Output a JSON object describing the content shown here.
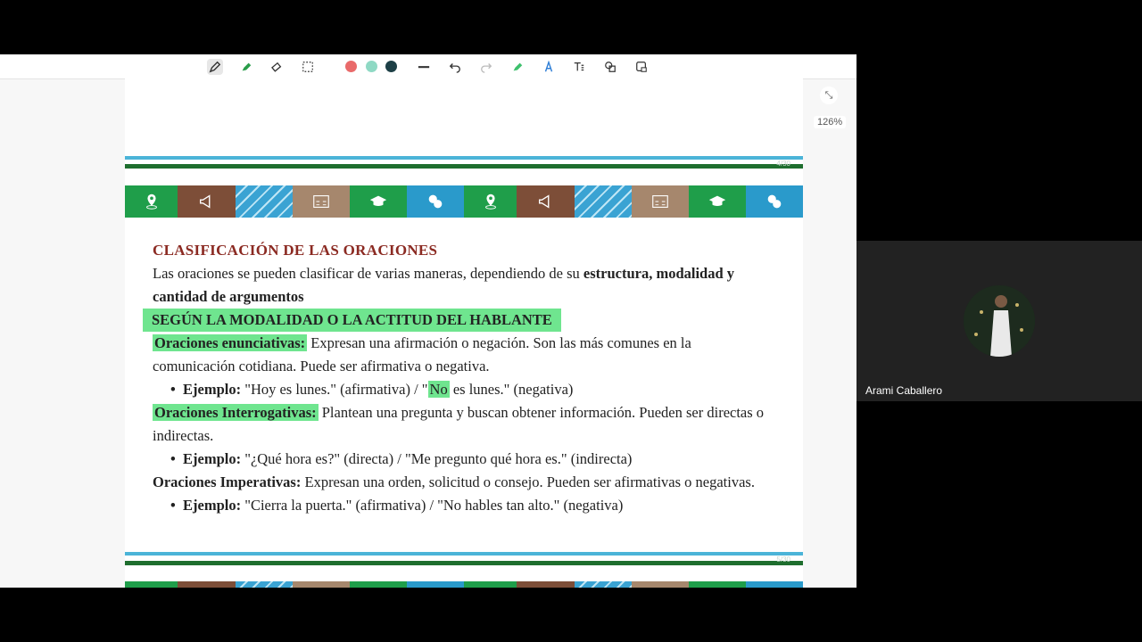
{
  "toolbar": {
    "tools": [
      "pen-icon",
      "highlighter-icon",
      "eraser-icon",
      "select-icon",
      "color-red",
      "color-teal",
      "color-dark",
      "stroke-width-icon",
      "undo-icon",
      "redo-icon",
      "marker-icon",
      "text-effect-icon",
      "text-box-icon",
      "shapes-icon",
      "lock-icon"
    ],
    "colors": {
      "red": "#e96a6a",
      "teal": "#8fd9c4",
      "dark": "#1d3f46"
    }
  },
  "zoom": "126%",
  "document": {
    "heading": "CLASIFICACIÓN DE LAS ORACIONES",
    "intro_normal": "Las oraciones se pueden clasificar de varias maneras, dependiendo de su ",
    "intro_bold": "estructura, modalidad y cantidad de argumentos",
    "subheading": "SEGÚN LA MODALIDAD O LA ACTITUD DEL HABLANTE",
    "items": [
      {
        "term": "Oraciones enunciativas:",
        "text": " Expresan una afirmación o negación. Son las más comunes en la comunicación cotidiana. Puede ser afirmativa o negativa.",
        "example_label": "Ejemplo:",
        "example_a": " \"Hoy es lunes.\" (afirmativa) / \"",
        "example_hl": "No",
        "example_b": " es lunes.\" (negativa)"
      },
      {
        "term": "Oraciones Interrogativas:",
        "text": " Plantean una pregunta y buscan obtener información. Pueden ser directas o indirectas.",
        "example_label": "Ejemplo:",
        "example": " \"¿Qué hora es?\" (directa) / \"Me pregunto qué hora es.\" (indirecta)"
      },
      {
        "term": "Oraciones Imperativas:",
        "text": " Expresan una orden, solicitud o consejo. Pueden ser afirmativas o negativas.",
        "example_label": "Ejemplo:",
        "example": " \"Cierra la puerta.\" (afirmativa) / \"No hables tan alto.\" (negativa)"
      }
    ],
    "page_numbers": [
      "4/30",
      "5/30"
    ]
  },
  "participant": {
    "name": "Arami Caballero"
  }
}
